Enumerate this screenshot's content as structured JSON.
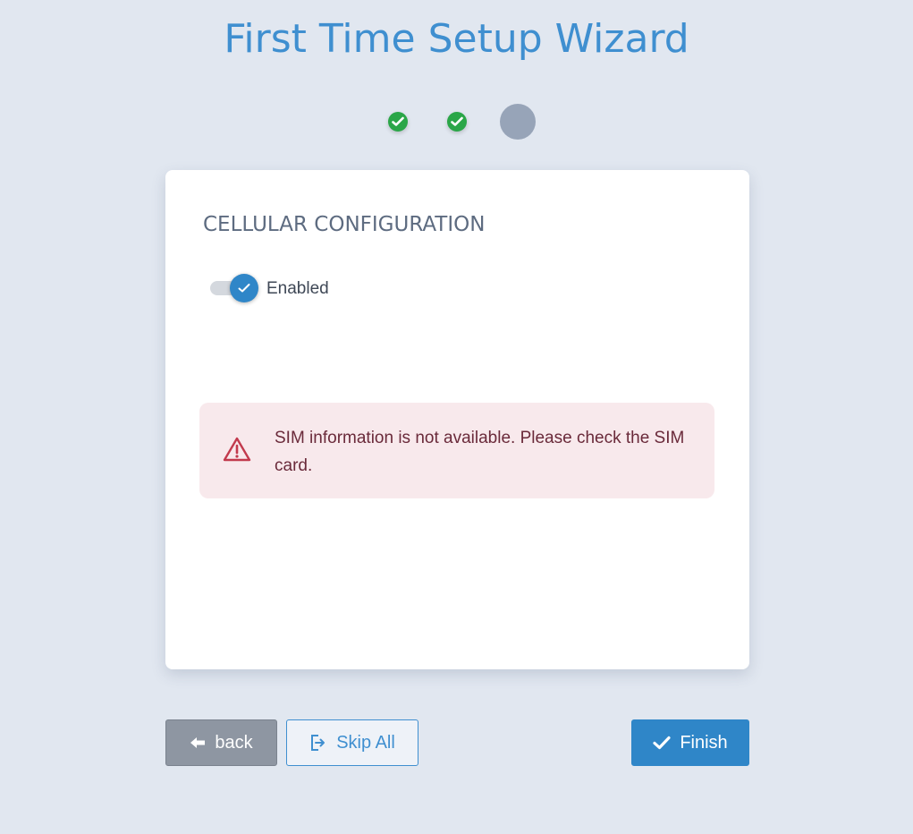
{
  "wizard": {
    "title": "First Time Setup Wizard"
  },
  "steps": {
    "items": [
      {
        "status": "complete",
        "icon": "check-icon"
      },
      {
        "status": "complete",
        "icon": "check-icon"
      },
      {
        "status": "current",
        "icon": ""
      }
    ],
    "colors": {
      "complete": "#2aa648",
      "current": "#97a4b8"
    }
  },
  "card": {
    "section_title": "CELLULAR CONFIGURATION",
    "toggle": {
      "label": "Enabled",
      "checked": true,
      "icon": "check-icon"
    },
    "alert": {
      "icon": "warning-triangle-icon",
      "message": "SIM information is not available. Please check the SIM card.",
      "color": "#c23a4d"
    }
  },
  "footer": {
    "back_label": "back",
    "back_icon": "arrow-left-icon",
    "skip_label": "Skip All",
    "skip_icon": "sign-out-icon",
    "finish_label": "Finish",
    "finish_icon": "check-icon"
  },
  "colors": {
    "accent": "#3f8fd0",
    "background": "#e1e7f0"
  }
}
